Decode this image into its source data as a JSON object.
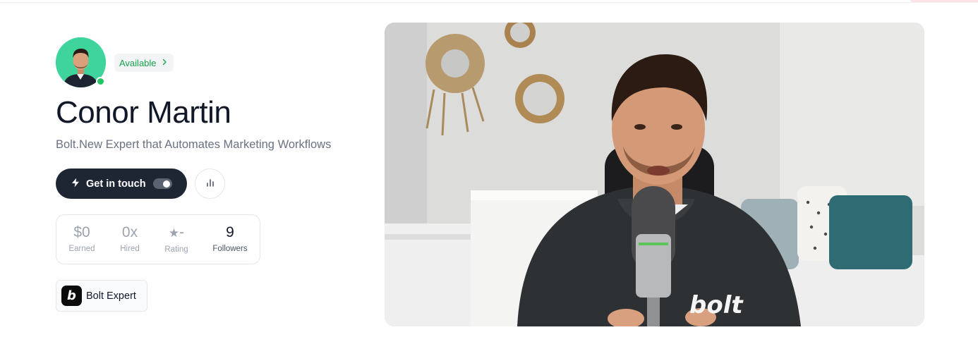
{
  "profile": {
    "name": "Conor Martin",
    "tagline": "Bolt.New Expert that Automates Marketing Workflows",
    "availability": "Available",
    "online": true
  },
  "actions": {
    "get_in_touch": "Get in touch"
  },
  "stats": [
    {
      "value": "$0",
      "label": "Earned"
    },
    {
      "value": "0x",
      "label": "Hired"
    },
    {
      "value": "-",
      "label": "Rating"
    },
    {
      "value": "9",
      "label": "Followers"
    }
  ],
  "badge": {
    "logo_letter": "b",
    "label": "Bolt Expert"
  },
  "video": {
    "shirt_text": "bolt"
  },
  "colors": {
    "available": "#16a34a",
    "cta_bg": "#1f2633",
    "avatar_bg": "#3fd49b",
    "online_dot": "#22c55e"
  },
  "icons": [
    "chevron-right-icon",
    "bolt-icon",
    "bar-chart-icon",
    "star-icon",
    "bolt-logo-icon"
  ]
}
